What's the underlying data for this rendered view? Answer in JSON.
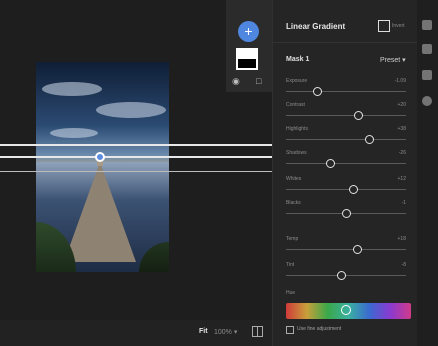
{
  "bottom_bar": {
    "fit_label": "Fit",
    "zoom_value": "100% ▾"
  },
  "mask_panel": {
    "add_label": "+"
  },
  "settings": {
    "title": "Linear Gradient",
    "invert_label": "Invert",
    "mask_name": "Mask 1",
    "preset_label": "Preset ▾",
    "sliders": [
      {
        "label": "Exposure",
        "value": "-1.09",
        "level": 0.26
      },
      {
        "label": "Contrast",
        "value": "+20",
        "level": 0.6
      },
      {
        "label": "Highlights",
        "value": "+38",
        "level": 0.69
      },
      {
        "label": "Shadows",
        "value": "-26",
        "level": 0.37
      },
      {
        "label": "Whites",
        "value": "+12",
        "level": 0.56
      },
      {
        "label": "Blacks",
        "value": "-1",
        "level": 0.5
      },
      {
        "label": "Temp",
        "value": "+18",
        "level": 0.59
      },
      {
        "label": "Tint",
        "value": "-8",
        "level": 0.46
      }
    ],
    "hue_label": "Hue",
    "hue_level": 0.48,
    "fine_adjust_label": "Use fine adjustment"
  },
  "colors": {
    "accent": "#4f86e0",
    "background": "#1b1b1b",
    "panel": "#252525"
  }
}
